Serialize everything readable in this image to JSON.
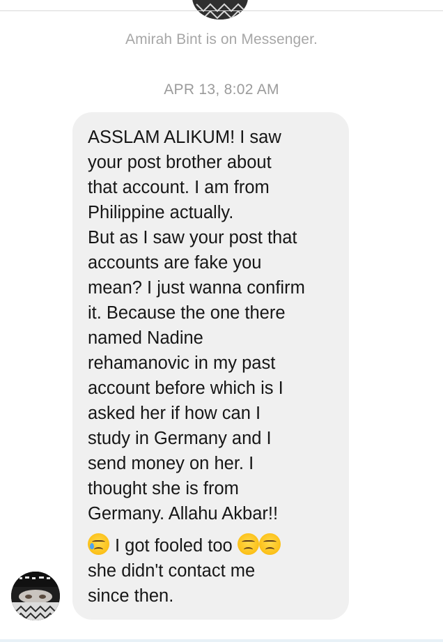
{
  "conversation": {
    "notice": "Amirah Bint is on Messenger.",
    "timestamp": "APR 13, 8:02 AM"
  },
  "message": {
    "paragraph1": "ASSLAM ALIKUM! I saw\nyour post brother about\nthat account. I am from\nPhilippine actually.\nBut as I saw your post that\naccounts are fake you\nmean? I just wanna confirm\nit. Because the one there\nnamed Nadine\nrehamanovic in my past\naccount before which is I\nasked her if how can I\nstudy in Germany and I\nsend money on her. I\nthought she is from\nGermany. Allahu Akbar!!",
    "paragraph2_part1": "I got fooled too ",
    "paragraph2_part2": "\nshe didn't contact me\nsince then.",
    "emojis": [
      "crying-face-emoji",
      "pensive-face-emoji",
      "pensive-face-emoji"
    ]
  },
  "sender": {
    "avatar": "profile-photo-keffiyeh"
  },
  "colors": {
    "bubble": "#f0f0f0",
    "meta_text": "#a7a7a7",
    "message_text": "#161616"
  }
}
